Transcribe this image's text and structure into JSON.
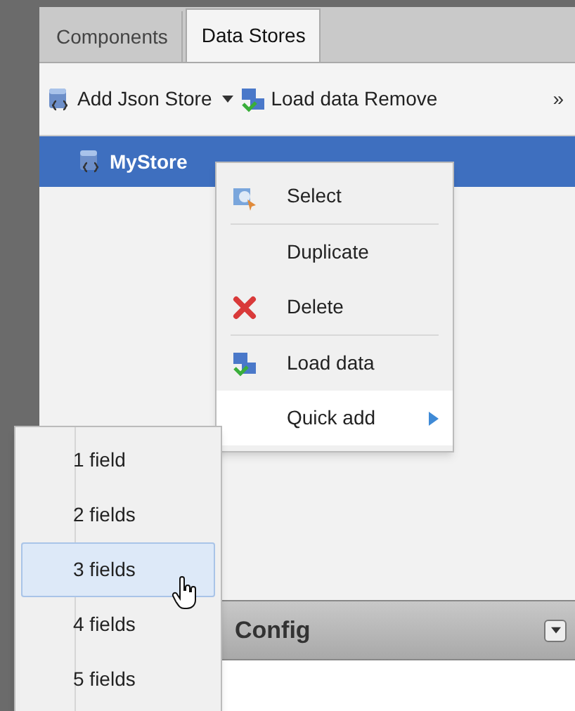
{
  "tabs": [
    {
      "label": "Components",
      "selected": false
    },
    {
      "label": "Data Stores",
      "selected": true
    }
  ],
  "toolbar": {
    "items": [
      {
        "label": "Add Json Store",
        "dropdown": true
      },
      {
        "label": "Load data",
        "dropdown": false
      },
      {
        "label": "Remove",
        "dropdown": false
      }
    ],
    "overflow": "»"
  },
  "tree": [
    {
      "label": "MyStore",
      "selected": true
    }
  ],
  "context_menu": {
    "items": [
      {
        "label": "Select",
        "separator_after": true,
        "active": false,
        "submenu": false
      },
      {
        "label": "Duplicate",
        "separator_after": false,
        "active": false,
        "submenu": false
      },
      {
        "label": "Delete",
        "separator_after": true,
        "active": false,
        "submenu": false
      },
      {
        "label": "Load data",
        "separator_after": false,
        "active": false,
        "submenu": false
      },
      {
        "label": "Quick add",
        "separator_after": false,
        "active": true,
        "submenu": true
      }
    ]
  },
  "submenu": {
    "items": [
      {
        "label": "1 field",
        "selected": false
      },
      {
        "label": "2 fields",
        "selected": false
      },
      {
        "label": "3 fields",
        "selected": true
      },
      {
        "label": "4 fields",
        "selected": false
      },
      {
        "label": "5 fields",
        "selected": false
      }
    ]
  },
  "config_panel": {
    "title": "Config"
  }
}
